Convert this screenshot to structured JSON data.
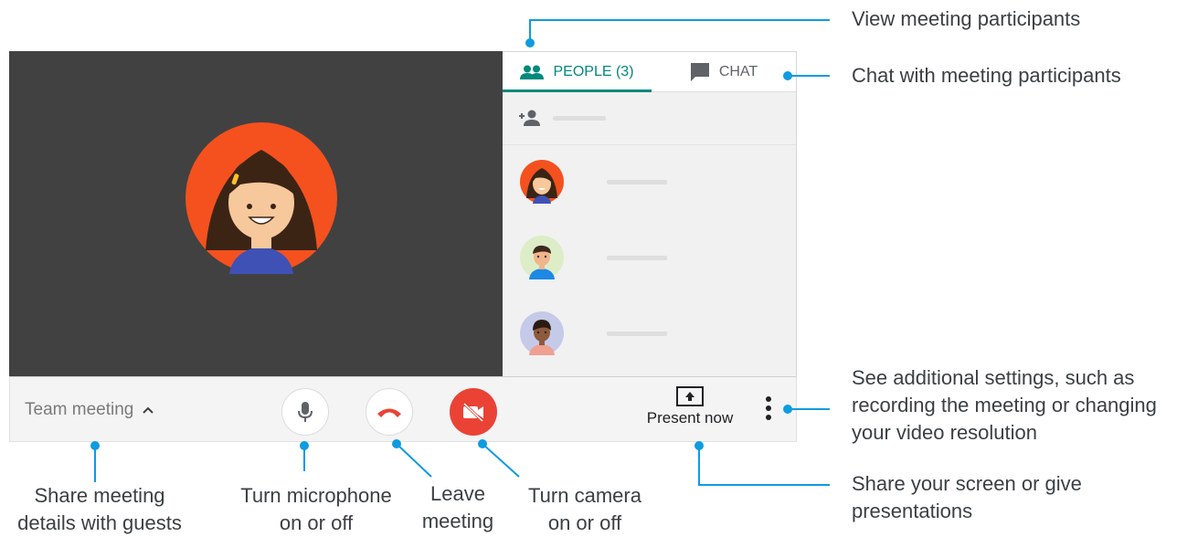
{
  "panel": {
    "people_tab_label": "PEOPLE (3)",
    "chat_tab_label": "CHAT",
    "people_icon": "people-icon",
    "chat_icon": "chat-bubble-icon",
    "add_person_icon": "add-person-icon"
  },
  "participants": [
    {
      "avatar": "girl-avatar",
      "bg": "#f4511e"
    },
    {
      "avatar": "boy-avatar",
      "bg": "#dcedc8"
    },
    {
      "avatar": "man-avatar",
      "bg": "#c5cae9"
    }
  ],
  "bottom_bar": {
    "meeting_name": "Team meeting",
    "present_label": "Present now",
    "icons": [
      "chevron-up-icon",
      "microphone-icon",
      "phone-hangup-icon",
      "camera-off-icon",
      "present-screen-icon",
      "more-vert-icon"
    ],
    "colors": {
      "leave": "#ea4335",
      "camera_off_bg": "#ea4335",
      "accent": "#00897b",
      "callout": "#0f9be0"
    }
  },
  "annotations": {
    "view_participants": "View meeting participants",
    "chat": "Chat with meeting participants",
    "settings_line1": "See additional settings, such as",
    "settings_line2": "recording the meeting or changing",
    "settings_line3": "your video resolution",
    "share_screen_line1": "Share your screen or give",
    "share_screen_line2": "presentations",
    "share_details_line1": "Share meeting",
    "share_details_line2": "details with guests",
    "mic_line1": "Turn microphone",
    "mic_line2": "on or off",
    "leave_line1": "Leave",
    "leave_line2": "meeting",
    "camera_line1": "Turn camera",
    "camera_line2": "on or off"
  }
}
